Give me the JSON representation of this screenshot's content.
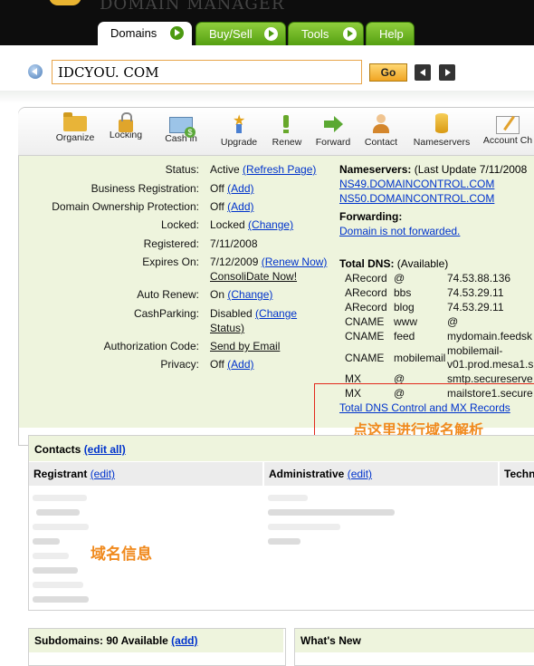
{
  "header": {
    "ghost_title": "DOMAIN MANAGER",
    "tabs": [
      {
        "label": "Domains",
        "active": true
      },
      {
        "label": "Buy/Sell",
        "active": false
      },
      {
        "label": "Tools",
        "active": false
      },
      {
        "label": "Help",
        "active": false
      }
    ]
  },
  "search": {
    "value": "IDCYOU. COM",
    "go_label": "Go"
  },
  "toolbar": [
    {
      "label": "Organize",
      "icon": "folder-icon"
    },
    {
      "label": "Locking",
      "icon": "lock-icon"
    },
    {
      "label": "Cash in",
      "icon": "cash-in-icon"
    },
    {
      "label": "Upgrade",
      "icon": "upgrade-icon"
    },
    {
      "label": "Renew",
      "icon": "renew-icon"
    },
    {
      "label": "Forward",
      "icon": "forward-icon"
    },
    {
      "label": "Contact",
      "icon": "contact-icon"
    },
    {
      "label": "Nameservers",
      "icon": "nameservers-icon"
    },
    {
      "label": "Account Ch",
      "icon": "account-change-icon"
    }
  ],
  "details": {
    "status": {
      "label": "Status:",
      "value": "Active",
      "link": "(Refresh Page)"
    },
    "business": {
      "label": "Business Registration:",
      "value": "Off",
      "link": "(Add)"
    },
    "ownership": {
      "label": "Domain Ownership Protection:",
      "value": "Off",
      "link": "(Add)"
    },
    "locked": {
      "label": "Locked:",
      "value": "Locked",
      "link": "(Change)"
    },
    "registered": {
      "label": "Registered:",
      "value": "7/11/2008"
    },
    "expires": {
      "label": "Expires On:",
      "value": "7/12/2009",
      "link": "(Renew Now)",
      "link2": "ConsoliDate Now!"
    },
    "autorenew": {
      "label": "Auto Renew:",
      "value": "On",
      "link": "(Change)"
    },
    "cashparking": {
      "label": "CashParking:",
      "value": "Disabled",
      "link_a": "(Change",
      "link_b": "Status)"
    },
    "authcode": {
      "label": "Authorization Code:",
      "link": "Send by Email"
    },
    "privacy": {
      "label": "Privacy:",
      "value": "Off",
      "link": "(Add)"
    }
  },
  "nameservers": {
    "title": "Nameservers:",
    "update": "(Last Update 7/11/2008",
    "ns1": "NS49.DOMAINCONTROL.COM",
    "ns2": "NS50.DOMAINCONTROL.COM",
    "forwarding_title": "Forwarding:",
    "forwarding_link": "Domain is not forwarded."
  },
  "dns": {
    "title": "Total DNS:",
    "available": "(Available)",
    "records": [
      {
        "type": "ARecord",
        "host": "@",
        "value": "74.53.88.136"
      },
      {
        "type": "ARecord",
        "host": "bbs",
        "value": "74.53.29.11"
      },
      {
        "type": "ARecord",
        "host": "blog",
        "value": "74.53.29.11"
      },
      {
        "type": "CNAME",
        "host": "www",
        "value": "@"
      },
      {
        "type": "CNAME",
        "host": "feed",
        "value": "mydomain.feedsk"
      },
      {
        "type": "CNAME",
        "host": "mobilemail",
        "value": "mobilemail-",
        "value2": "v01.prod.mesa1.s"
      },
      {
        "type": "MX",
        "host": "@",
        "value": "smtp.secureserve"
      },
      {
        "type": "MX",
        "host": "@",
        "value": "mailstore1.secure"
      }
    ],
    "control_link": "Total DNS Control and MX Records",
    "annotation": "点这里进行域名解析"
  },
  "contacts": {
    "title": "Contacts",
    "edit_all": "(edit all)",
    "columns": [
      {
        "label": "Registrant",
        "edit": "(edit)"
      },
      {
        "label": "Administrative",
        "edit": "(edit)"
      },
      {
        "label": "Techn",
        "edit": ""
      }
    ],
    "annotation": "域名信息"
  },
  "subdomains": {
    "title": "Subdomains: 90 Available",
    "add": "(add)"
  },
  "whats_new": {
    "title": "What's New"
  }
}
